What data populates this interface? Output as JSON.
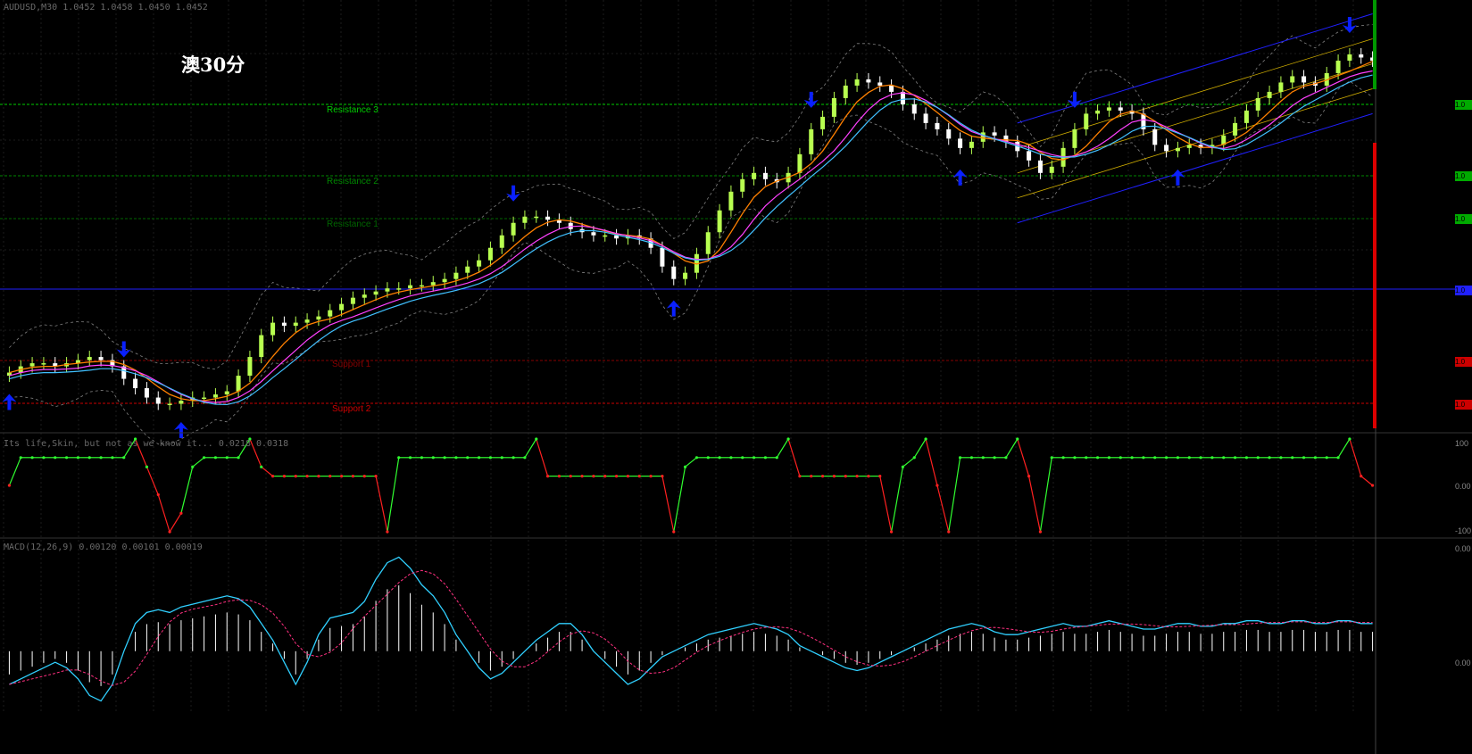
{
  "main": {
    "symbol_label": "AUDUSD,M30",
    "quote_text": "1.0452 1.0458 1.0450 1.0452",
    "title": "澳30分"
  },
  "levels": [
    {
      "label": "Resistance 3",
      "color": "#00cc00"
    },
    {
      "label": "Resistance 2",
      "color": "#008800"
    },
    {
      "label": "Resistance 1",
      "color": "#006600"
    },
    {
      "label": "Support 1",
      "color": "#880000"
    },
    {
      "label": "Support 2",
      "color": "#cc0000"
    }
  ],
  "price_tags": [
    {
      "text": "1.0",
      "color": "#00aa00"
    },
    {
      "text": "1.0",
      "color": "#00aa00"
    },
    {
      "text": "1.0",
      "color": "#00aa00"
    },
    {
      "text": "1.0",
      "color": "#2020ff"
    },
    {
      "text": "1.0",
      "color": "#cc0000"
    },
    {
      "text": "1.0",
      "color": "#cc0000"
    }
  ],
  "indicator1": {
    "label": "Its life,Skin, but not as we know it...",
    "values_text": "0.0218 0.0318",
    "scale_top": "100",
    "scale_mid": "0.00",
    "scale_bottom": "-100"
  },
  "macd": {
    "label": "MACD(12,26,9)",
    "values_text": "0.00120 0.00101 0.00019",
    "scale_top": "0.00",
    "scale_mid": "0.00"
  },
  "colors": {
    "background": "#000000",
    "bull_candle": "#b8ff50",
    "bear_candle": "#ffffff",
    "ma_fast": "#ff8000",
    "ma_slow": "#ff40ff",
    "ma_cyan": "#40c0ff",
    "bands": "#808080",
    "channel_outer": "#2020ff",
    "channel_inner": "#ccaa00",
    "pivot_blue": "#2020ff",
    "osc_up": "#30ff30",
    "osc_down": "#ff2020",
    "macd_line": "#30d0ff",
    "macd_signal": "#ff3080",
    "macd_hist": "#ffffff",
    "arrow": "#0a20ff"
  },
  "chart_data": {
    "type": "candlestick",
    "title": "澳30分",
    "series_note": "AUDUSD 30-minute price series (approximate normalized shape, price units not printed)",
    "price_series": [
      0.5,
      0.52,
      0.53,
      0.53,
      0.52,
      0.53,
      0.54,
      0.55,
      0.54,
      0.52,
      0.48,
      0.45,
      0.42,
      0.4,
      0.4,
      0.41,
      0.42,
      0.42,
      0.43,
      0.44,
      0.49,
      0.55,
      0.62,
      0.66,
      0.65,
      0.66,
      0.67,
      0.68,
      0.7,
      0.72,
      0.74,
      0.75,
      0.76,
      0.77,
      0.77,
      0.78,
      0.78,
      0.79,
      0.8,
      0.82,
      0.84,
      0.86,
      0.9,
      0.94,
      0.98,
      1.0,
      1.0,
      0.99,
      0.98,
      0.96,
      0.95,
      0.94,
      0.94,
      0.93,
      0.94,
      0.93,
      0.9,
      0.84,
      0.8,
      0.82,
      0.88,
      0.95,
      1.02,
      1.08,
      1.12,
      1.14,
      1.12,
      1.11,
      1.14,
      1.2,
      1.28,
      1.32,
      1.38,
      1.42,
      1.44,
      1.43,
      1.42,
      1.4,
      1.36,
      1.33,
      1.3,
      1.28,
      1.25,
      1.22,
      1.24,
      1.27,
      1.26,
      1.24,
      1.21,
      1.18,
      1.14,
      1.16,
      1.22,
      1.28,
      1.33,
      1.34,
      1.35,
      1.34,
      1.33,
      1.28,
      1.23,
      1.21,
      1.22,
      1.23,
      1.22,
      1.23,
      1.26,
      1.3,
      1.34,
      1.38,
      1.4,
      1.43,
      1.45,
      1.43,
      1.42,
      1.46,
      1.5,
      1.52,
      1.51,
      1.5
    ],
    "oscillator_series": [
      0,
      60,
      60,
      60,
      60,
      60,
      60,
      60,
      60,
      60,
      60,
      100,
      40,
      -20,
      -100,
      -60,
      40,
      60,
      60,
      60,
      60,
      100,
      40,
      20,
      20,
      20,
      20,
      20,
      20,
      20,
      20,
      20,
      20,
      -100,
      60,
      60,
      60,
      60,
      60,
      60,
      60,
      60,
      60,
      60,
      60,
      60,
      100,
      20,
      20,
      20,
      20,
      20,
      20,
      20,
      20,
      20,
      20,
      20,
      -100,
      40,
      60,
      60,
      60,
      60,
      60,
      60,
      60,
      60,
      100,
      20,
      20,
      20,
      20,
      20,
      20,
      20,
      20,
      -100,
      40,
      60,
      100,
      0,
      -100,
      60,
      60,
      60,
      60,
      60,
      100,
      20,
      -100,
      60,
      60,
      60,
      60,
      60,
      60,
      60,
      60,
      60,
      60,
      60,
      60,
      60,
      60,
      60,
      60,
      60,
      60,
      60,
      60,
      60,
      60,
      60,
      60,
      60,
      60,
      100,
      20,
      0
    ],
    "macd_series": [
      -0.6,
      -0.5,
      -0.4,
      -0.3,
      -0.2,
      -0.3,
      -0.5,
      -0.8,
      -0.9,
      -0.6,
      0.0,
      0.5,
      0.7,
      0.75,
      0.7,
      0.8,
      0.85,
      0.9,
      0.95,
      1.0,
      0.95,
      0.8,
      0.5,
      0.2,
      -0.2,
      -0.6,
      -0.2,
      0.3,
      0.6,
      0.65,
      0.7,
      0.9,
      1.3,
      1.6,
      1.7,
      1.5,
      1.2,
      1.0,
      0.7,
      0.3,
      0.0,
      -0.3,
      -0.5,
      -0.4,
      -0.2,
      0.0,
      0.2,
      0.35,
      0.5,
      0.5,
      0.3,
      0.0,
      -0.2,
      -0.4,
      -0.6,
      -0.5,
      -0.3,
      -0.1,
      0.0,
      0.1,
      0.2,
      0.3,
      0.35,
      0.4,
      0.45,
      0.5,
      0.45,
      0.4,
      0.3,
      0.1,
      0.0,
      -0.1,
      -0.2,
      -0.3,
      -0.35,
      -0.3,
      -0.2,
      -0.1,
      0.0,
      0.1,
      0.2,
      0.3,
      0.4,
      0.45,
      0.5,
      0.45,
      0.35,
      0.3,
      0.3,
      0.35,
      0.4,
      0.45,
      0.5,
      0.45,
      0.45,
      0.5,
      0.55,
      0.5,
      0.45,
      0.4,
      0.4,
      0.45,
      0.5,
      0.5,
      0.45,
      0.45,
      0.5,
      0.5,
      0.55,
      0.55,
      0.5,
      0.5,
      0.55,
      0.55,
      0.5,
      0.5,
      0.55,
      0.55,
      0.5,
      0.5
    ],
    "up_arrow_indices": [
      0,
      15,
      58,
      83,
      102
    ],
    "down_arrow_indices": [
      10,
      44,
      70,
      93,
      117
    ],
    "ylabel": "",
    "xlabel": ""
  }
}
